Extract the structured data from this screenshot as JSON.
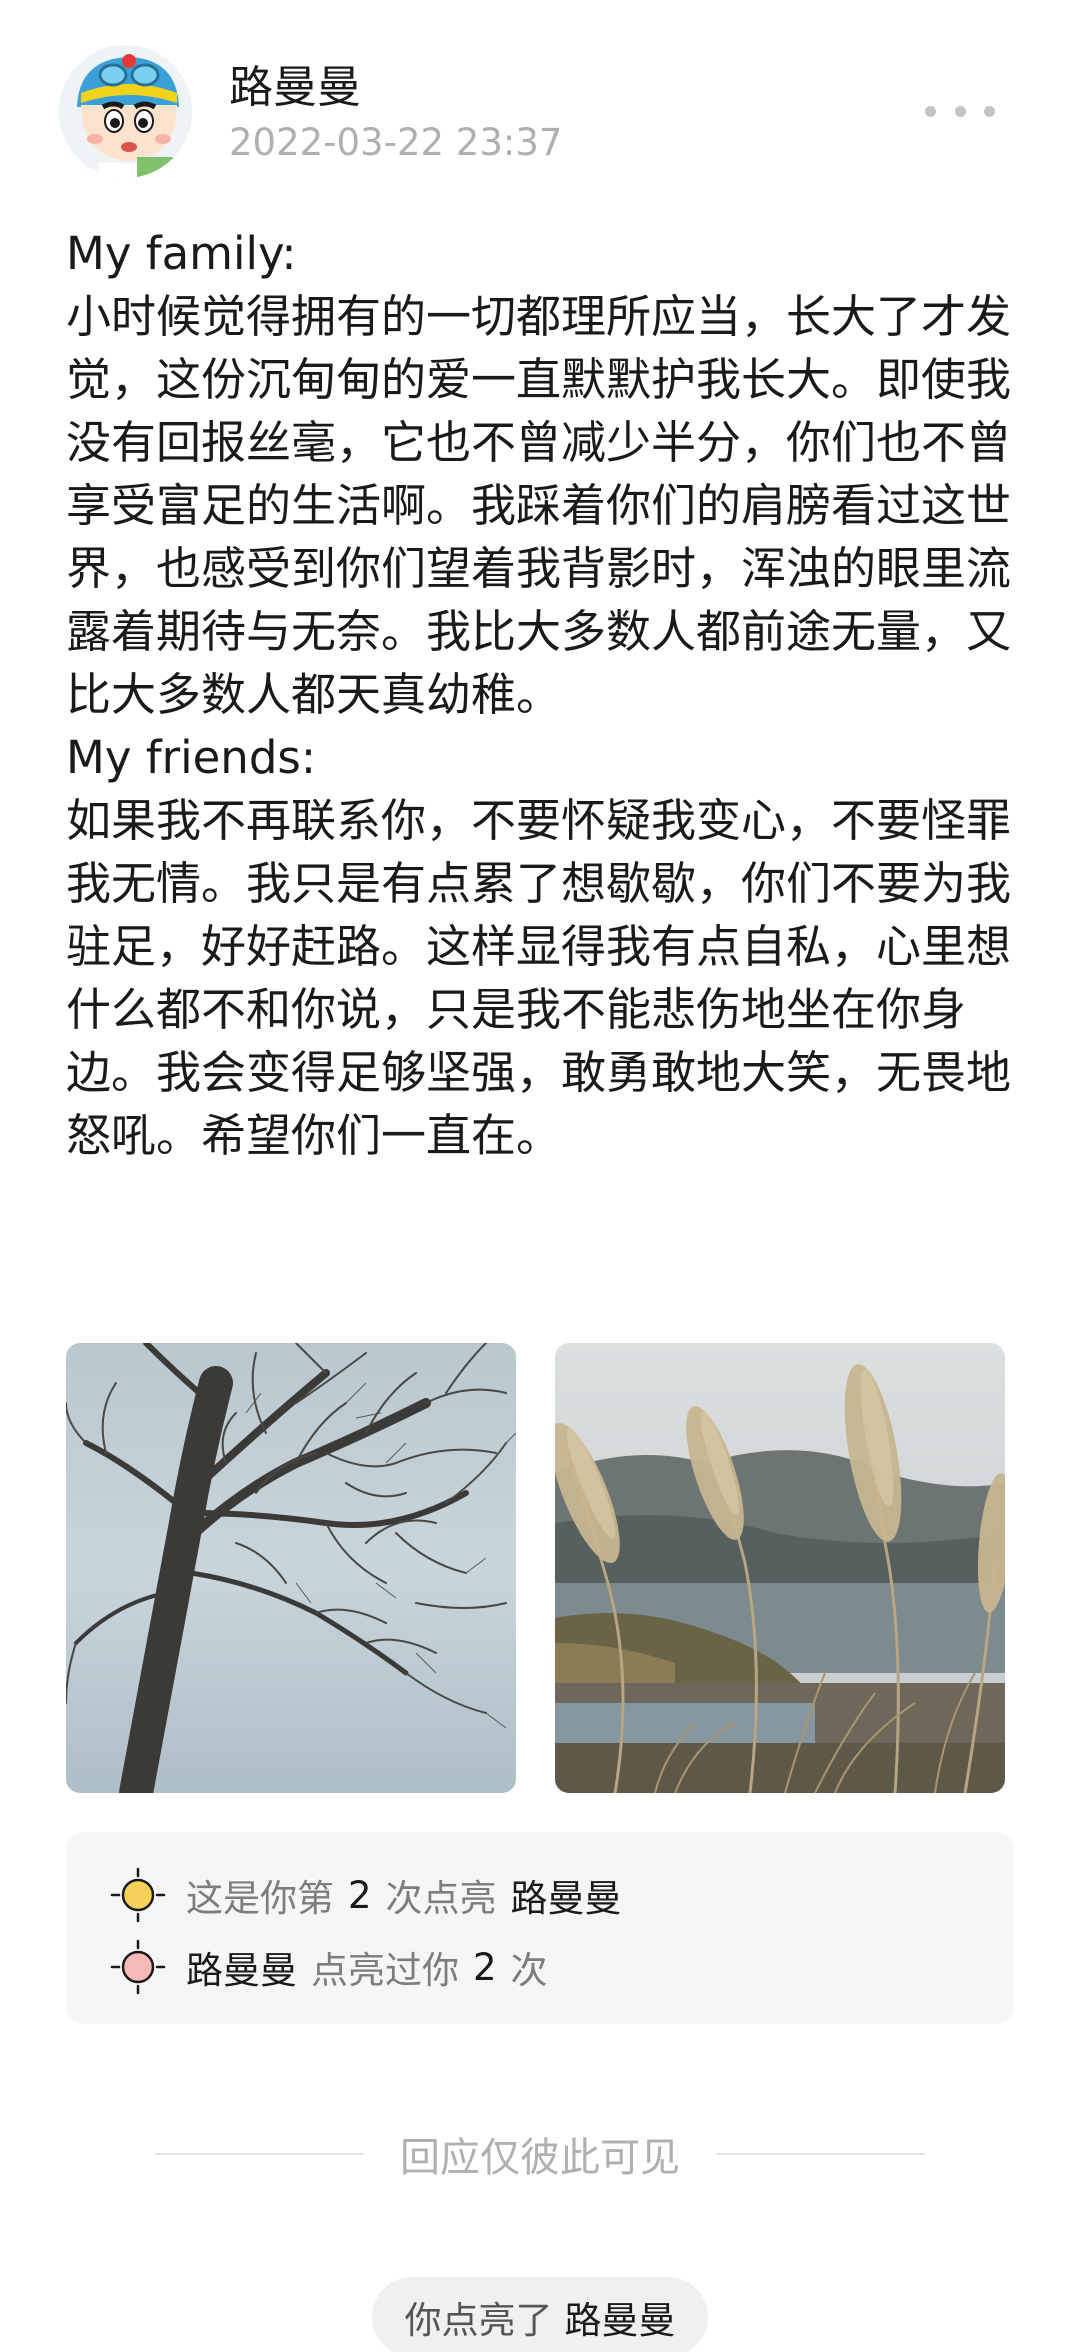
{
  "post": {
    "author": "路曼曼",
    "time": "2022-03-22 23:37",
    "text": "My family:\n小时候觉得拥有的一切都理所应当，长大了才发觉，这份沉甸甸的爱一直默默护我长大。即使我没有回报丝毫，它也不曾减少半分，你们也不曾享受富足的生活啊。我踩着你们的肩膀看过这世界，也感受到你们望着我背影时，浑浊的眼里流露着期待与无奈。我比大多数人都前途无量，又比大多数人都天真幼稚。\nMy friends:\n如果我不再联系你，不要怀疑我变心，不要怪罪我无情。我只是有点累了想歇歇，你们不要为我驻足，好好赶路。这样显得我有点自私，心里想什么都不和你说，只是我不能悲伤地坐在你身边。我会变得足够坚强，敢勇敢地大笑，无畏地怒吼。希望你们一直在。"
  },
  "likes": {
    "row1": {
      "prefix": "这是你第",
      "count": "2",
      "suffix": "次点亮",
      "name": "路曼曼",
      "icon_color": "#f5d35a"
    },
    "row2": {
      "name": "路曼曼",
      "middle": "点亮过你",
      "count": "2",
      "suffix": "次",
      "icon_color": "#f7b8b8"
    }
  },
  "reply_note": "回应仅彼此可见",
  "bottom": {
    "prefix": "你点亮了",
    "name": "路曼曼"
  }
}
